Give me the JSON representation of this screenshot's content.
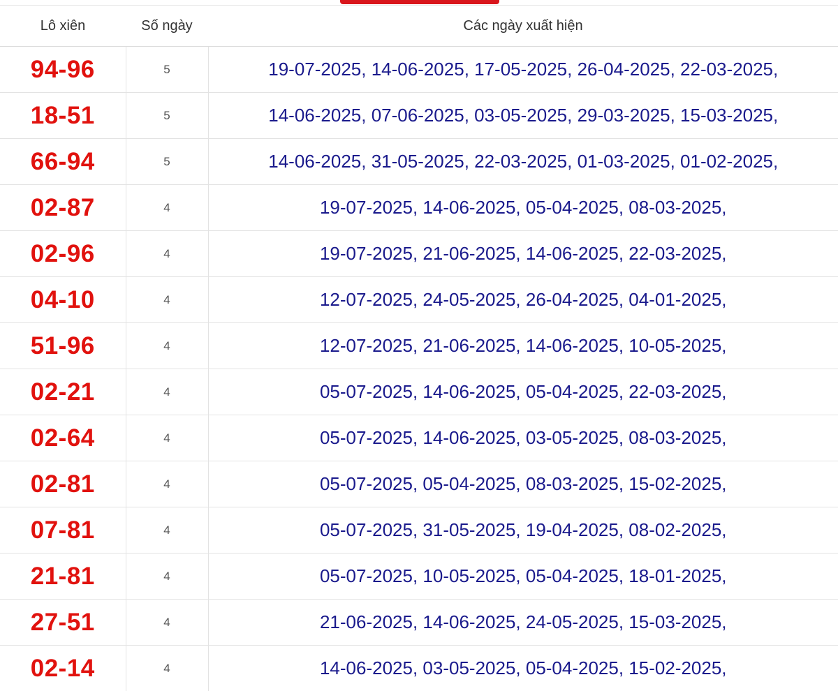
{
  "header": {
    "col_pair": "Lô xiên",
    "col_count": "Số ngày",
    "col_dates": "Các ngày xuất hiện"
  },
  "colors": {
    "accent_tab": "#d9161c",
    "pair_text": "#e1120e",
    "date_text": "#1a1a8c"
  },
  "rows": [
    {
      "pair": "94-96",
      "count": "5",
      "dates": "19-07-2025, 14-06-2025, 17-05-2025, 26-04-2025, 22-03-2025,"
    },
    {
      "pair": "18-51",
      "count": "5",
      "dates": "14-06-2025, 07-06-2025, 03-05-2025, 29-03-2025, 15-03-2025,"
    },
    {
      "pair": "66-94",
      "count": "5",
      "dates": "14-06-2025, 31-05-2025, 22-03-2025, 01-03-2025, 01-02-2025,"
    },
    {
      "pair": "02-87",
      "count": "4",
      "dates": "19-07-2025, 14-06-2025, 05-04-2025, 08-03-2025,"
    },
    {
      "pair": "02-96",
      "count": "4",
      "dates": "19-07-2025, 21-06-2025, 14-06-2025, 22-03-2025,"
    },
    {
      "pair": "04-10",
      "count": "4",
      "dates": "12-07-2025, 24-05-2025, 26-04-2025, 04-01-2025,"
    },
    {
      "pair": "51-96",
      "count": "4",
      "dates": "12-07-2025, 21-06-2025, 14-06-2025, 10-05-2025,"
    },
    {
      "pair": "02-21",
      "count": "4",
      "dates": "05-07-2025, 14-06-2025, 05-04-2025, 22-03-2025,"
    },
    {
      "pair": "02-64",
      "count": "4",
      "dates": "05-07-2025, 14-06-2025, 03-05-2025, 08-03-2025,"
    },
    {
      "pair": "02-81",
      "count": "4",
      "dates": "05-07-2025, 05-04-2025, 08-03-2025, 15-02-2025,"
    },
    {
      "pair": "07-81",
      "count": "4",
      "dates": "05-07-2025, 31-05-2025, 19-04-2025, 08-02-2025,"
    },
    {
      "pair": "21-81",
      "count": "4",
      "dates": "05-07-2025, 10-05-2025, 05-04-2025, 18-01-2025,"
    },
    {
      "pair": "27-51",
      "count": "4",
      "dates": "21-06-2025, 14-06-2025, 24-05-2025, 15-03-2025,"
    },
    {
      "pair": "02-14",
      "count": "4",
      "dates": "14-06-2025, 03-05-2025, 05-04-2025, 15-02-2025,"
    }
  ]
}
